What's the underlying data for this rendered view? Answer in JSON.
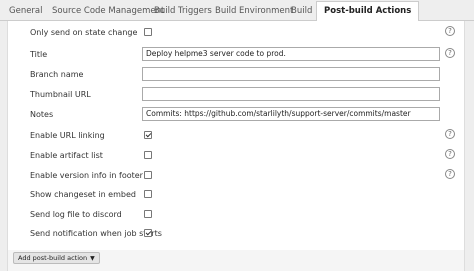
{
  "tabs": [
    {
      "label": "General"
    },
    {
      "label": "Source Code Management"
    },
    {
      "label": "Build Triggers"
    },
    {
      "label": "Build Environment"
    },
    {
      "label": "Build"
    },
    {
      "label": "Post-build Actions"
    }
  ],
  "active_tab": "Post-build Actions",
  "form": {
    "only_send_on_state_change": {
      "label": "Only send on state change",
      "checked": false
    },
    "title": {
      "label": "Title",
      "value": "Deploy helpme3 server code to prod."
    },
    "branch_name": {
      "label": "Branch name",
      "value": ""
    },
    "thumbnail_url": {
      "label": "Thumbnail URL",
      "value": ""
    },
    "notes": {
      "label": "Notes",
      "value": "Commits: https://github.com/starlilyth/support-server/commits/master"
    },
    "enable_url_linking": {
      "label": "Enable URL linking",
      "checked": true
    },
    "enable_artifact_list": {
      "label": "Enable artifact list",
      "checked": false
    },
    "enable_version_info": {
      "label": "Enable version info in footer",
      "checked": false
    },
    "show_changeset": {
      "label": "Show changeset in embed",
      "checked": false
    },
    "send_log_file": {
      "label": "Send log file to discord",
      "checked": false
    },
    "send_notification_on_start": {
      "label": "Send notification when job starts",
      "checked": true
    }
  },
  "help_icon_glyph": "?",
  "add_post_build_action": {
    "label": "Add post-build action",
    "caret": "▼"
  }
}
